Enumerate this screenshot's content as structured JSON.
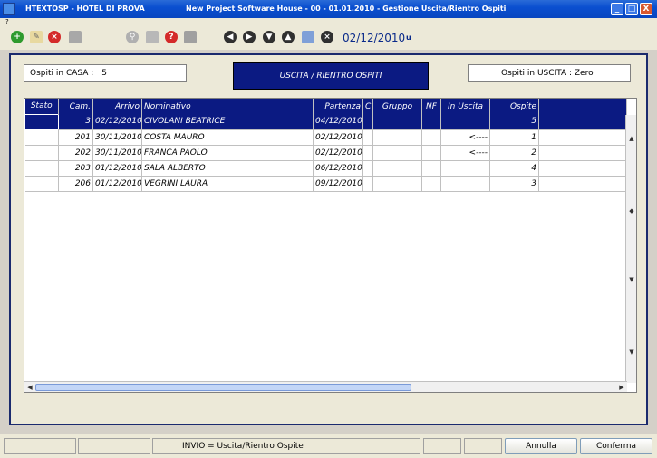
{
  "window": {
    "app_name": "HTEXTOSP - HOTEL DI PROVA",
    "title": "New Project Software House  -  00  -  01.01.2010  -  Gestione Uscita/Rientro Ospiti",
    "minimize": "_",
    "maximize": "□",
    "close": "X"
  },
  "menu": {
    "help": "?"
  },
  "toolbar": {
    "date": "02/12/2010",
    "user": "u"
  },
  "header": {
    "ospiti_casa_label": "Ospiti in CASA :",
    "ospiti_casa_value": "5",
    "title": "USCITA / RIENTRO OSPITI",
    "ospiti_uscita": "Ospiti in USCITA : Zero"
  },
  "table": {
    "columns": [
      "Stato",
      "Cam.",
      "Arrivo",
      "Nominativo",
      "Partenza",
      "C",
      "Gruppo",
      "NF",
      "In Uscita",
      "Ospite"
    ],
    "rows": [
      {
        "stato": "",
        "cam": "3",
        "arrivo": "02/12/2010",
        "nominativo": "CIVOLANI BEATRICE",
        "partenza": "04/12/2010",
        "c": "",
        "gruppo": "",
        "nf": "",
        "uscita": "",
        "ospite": "5"
      },
      {
        "stato": "",
        "cam": "201",
        "arrivo": "30/11/2010",
        "nominativo": "COSTA MAURO",
        "partenza": "02/12/2010",
        "c": "",
        "gruppo": "",
        "nf": "",
        "uscita": "<----",
        "ospite": "1"
      },
      {
        "stato": "",
        "cam": "202",
        "arrivo": "30/11/2010",
        "nominativo": "FRANCA PAOLO",
        "partenza": "02/12/2010",
        "c": "",
        "gruppo": "",
        "nf": "",
        "uscita": "<----",
        "ospite": "2"
      },
      {
        "stato": "",
        "cam": "203",
        "arrivo": "01/12/2010",
        "nominativo": "SALA ALBERTO",
        "partenza": "06/12/2010",
        "c": "",
        "gruppo": "",
        "nf": "",
        "uscita": "",
        "ospite": "4"
      },
      {
        "stato": "",
        "cam": "206",
        "arrivo": "01/12/2010",
        "nominativo": "VEGRINI LAURA",
        "partenza": "09/12/2010",
        "c": "",
        "gruppo": "",
        "nf": "",
        "uscita": "",
        "ospite": "3"
      }
    ]
  },
  "status": {
    "hint": "INVIO = Uscita/Rientro Ospite",
    "annulla": "Annulla",
    "conferma": "Conferma"
  },
  "colors": {
    "selection": "#0b1a82",
    "titlebar": "#0a4fd0"
  }
}
